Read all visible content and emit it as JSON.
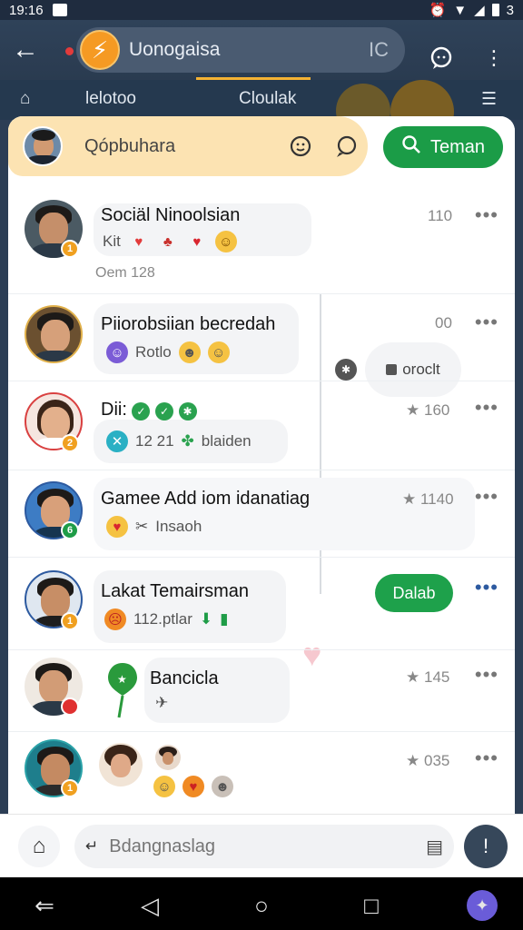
{
  "statusbar": {
    "time": "19:16",
    "right_text": "3"
  },
  "appbar": {
    "title": "Uonogaisa",
    "title_suffix": "IC"
  },
  "tabs": [
    "lelotoo",
    "Cloulak"
  ],
  "search": {
    "label": "Qópbuhara",
    "teman_label": "Teman"
  },
  "rows": [
    {
      "name": "Sociäl Ninoolsian",
      "sub_text": "Kit",
      "meta": "110",
      "time": "Oem 128",
      "badge_text": "1",
      "badge_color": "#f0a020"
    },
    {
      "name": "Piiorobsiian becredah",
      "sub_text": "Rotlo",
      "meta": "00",
      "badge_text": "",
      "badge_color": ""
    },
    {
      "name": "Dii:",
      "sub_text": "12 21",
      "sub_text2": "blaiden",
      "meta": "160",
      "badge_text": "2",
      "badge_color": "#f0a020"
    },
    {
      "name": "Gamee Add iom idanatiag",
      "sub_text": "Insaoh",
      "meta": "1140",
      "badge_text": "6",
      "badge_color": "#1e9c47"
    },
    {
      "name": "Lakat Temairsman",
      "sub_text": "112.ptlar",
      "meta": "",
      "badge_text": "1",
      "badge_color": "#f0a020",
      "action_label": "Dalab"
    },
    {
      "name": "Bancicla",
      "sub_text": "",
      "meta": "145",
      "badge_text": "",
      "badge_color": "#e03030"
    },
    {
      "name": "",
      "sub_text": "",
      "meta": "035",
      "badge_text": "1",
      "badge_color": "#f0a020"
    }
  ],
  "float_pill": "oroclt",
  "composer": {
    "placeholder": "Bdangnaslag"
  },
  "icons": [
    "back-arrow-icon",
    "flash-logo-icon",
    "chat-bubble-icon",
    "more-vert-icon",
    "home-icon",
    "menu-icon",
    "search-icon",
    "smiley-icon",
    "comment-icon",
    "star-icon",
    "heart-icon",
    "clip-icon",
    "exclamation-icon",
    "nav-back-icon",
    "nav-home-icon",
    "nav-recents-icon"
  ],
  "colors": {
    "accent_green": "#1b9c47",
    "appbar": "#2f4259",
    "search_bg": "#fce3b2",
    "logo_orange": "#f59a23"
  }
}
